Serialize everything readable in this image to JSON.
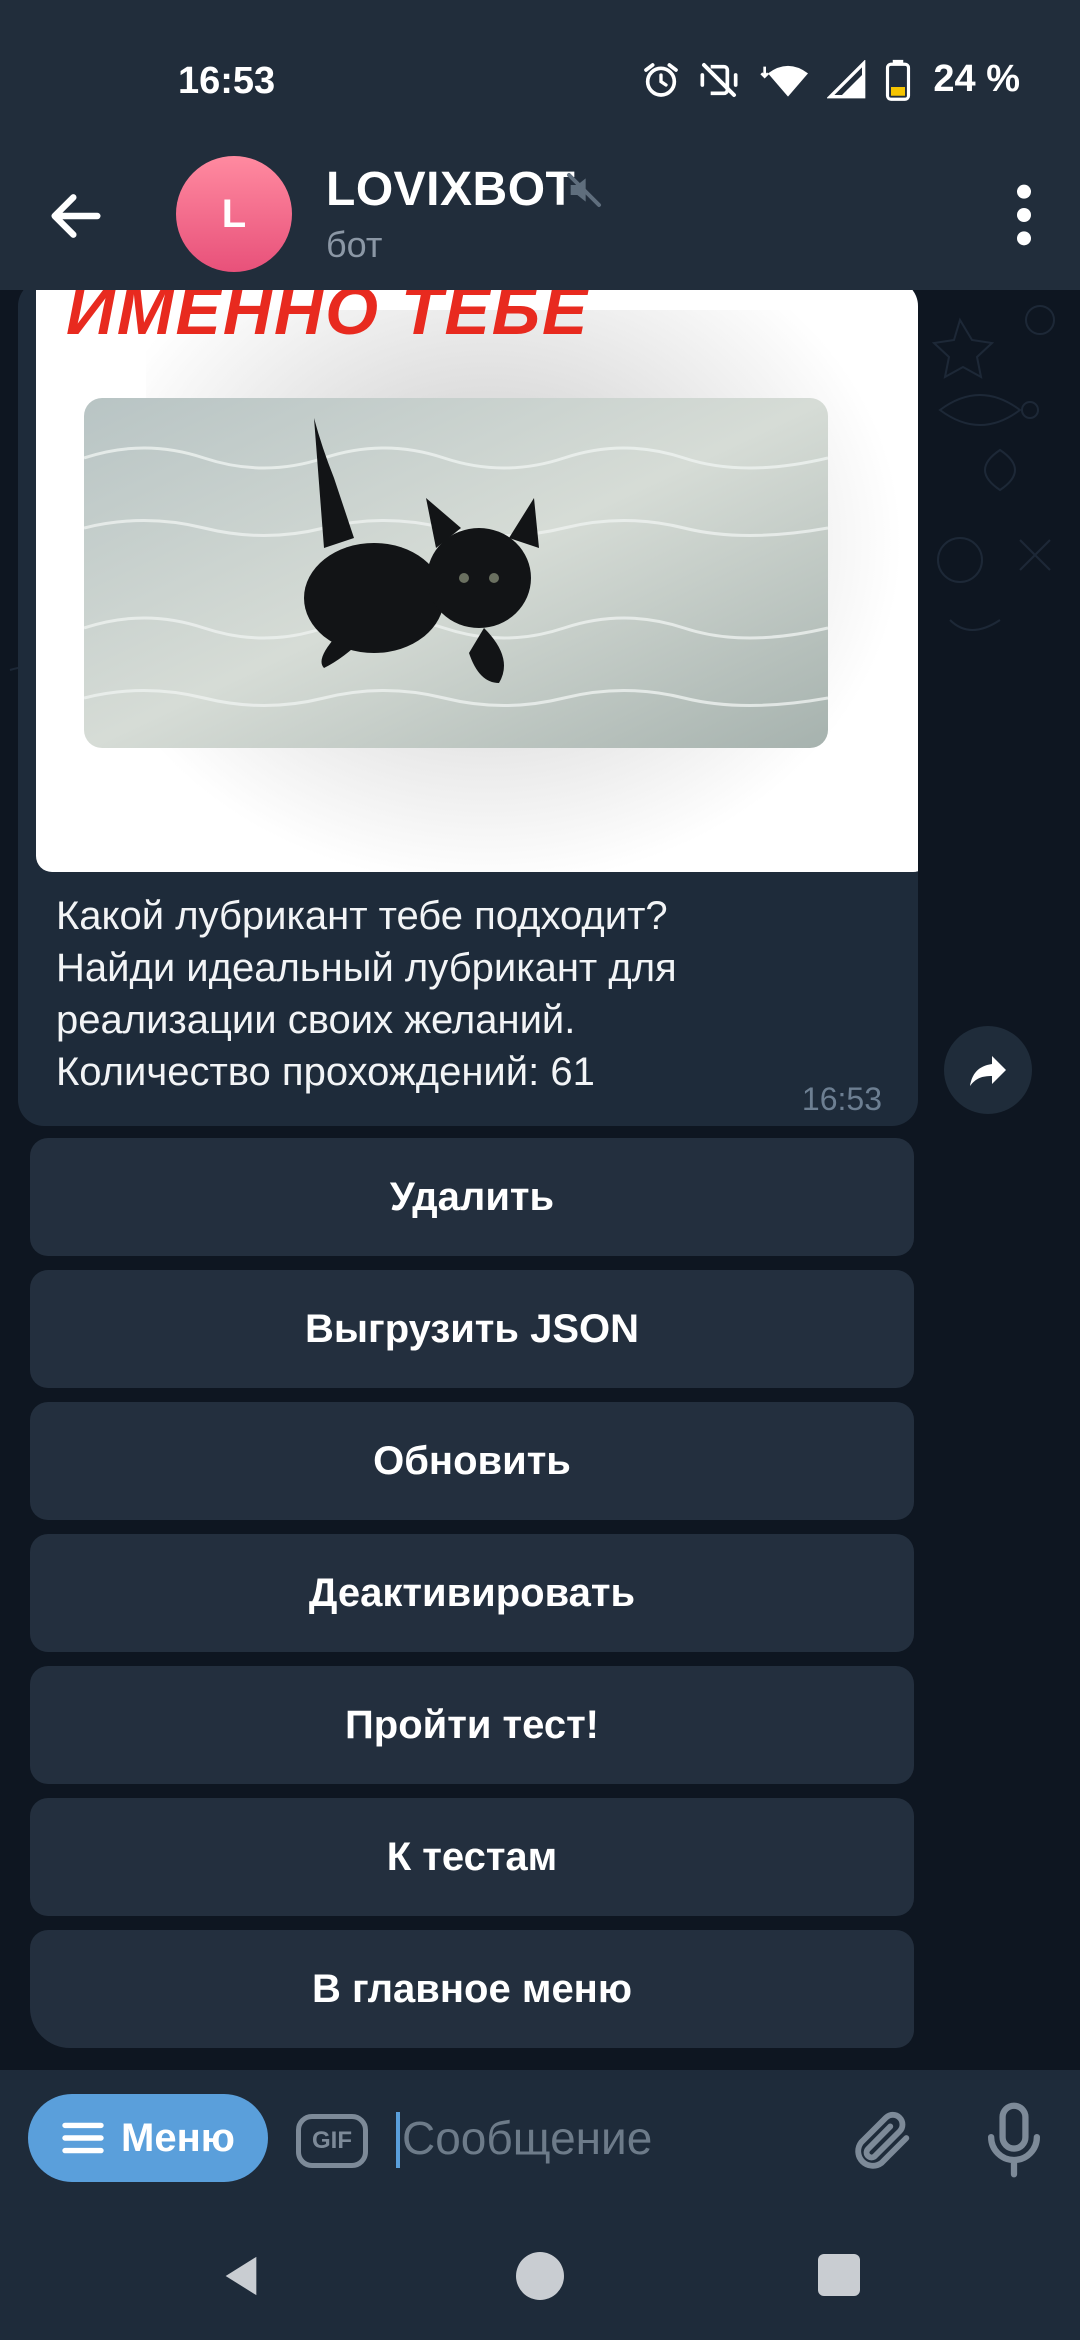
{
  "status_bar": {
    "time": "16:53",
    "battery": "24 %",
    "icons": [
      "alarm-icon",
      "vibrate-off-icon",
      "wifi-icon",
      "signal-icon",
      "battery-icon"
    ]
  },
  "header": {
    "avatar_letter": "L",
    "title": "LOVIXBOT",
    "subtitle": "бот",
    "icons": [
      "back-arrow-icon",
      "muted-icon",
      "more-vert-icon"
    ]
  },
  "message": {
    "media_heading": "ИМЕННО ТЕБЕ",
    "caption_lines": [
      "Какой лубрикант тебе подходит?",
      "Найди идеальный лубрикант для",
      "реализации своих желаний.",
      "Количество прохождений: 61"
    ],
    "time": "16:53"
  },
  "keyboard_buttons": [
    "Удалить",
    "Выгрузить JSON",
    "Обновить",
    "Деактивировать",
    "Пройти тест!",
    "К тестам",
    "В главное меню"
  ],
  "input_bar": {
    "menu_label": "Меню",
    "gif_label": "GIF",
    "placeholder": "Сообщение"
  },
  "colors": {
    "header_bg": "#212d3b",
    "chat_bg": "#0e1621",
    "bubble_bg": "#1e2b3a",
    "button_bg": "#232f3e",
    "accent": "#5a9fdb",
    "heading_red": "#e82a1f"
  }
}
